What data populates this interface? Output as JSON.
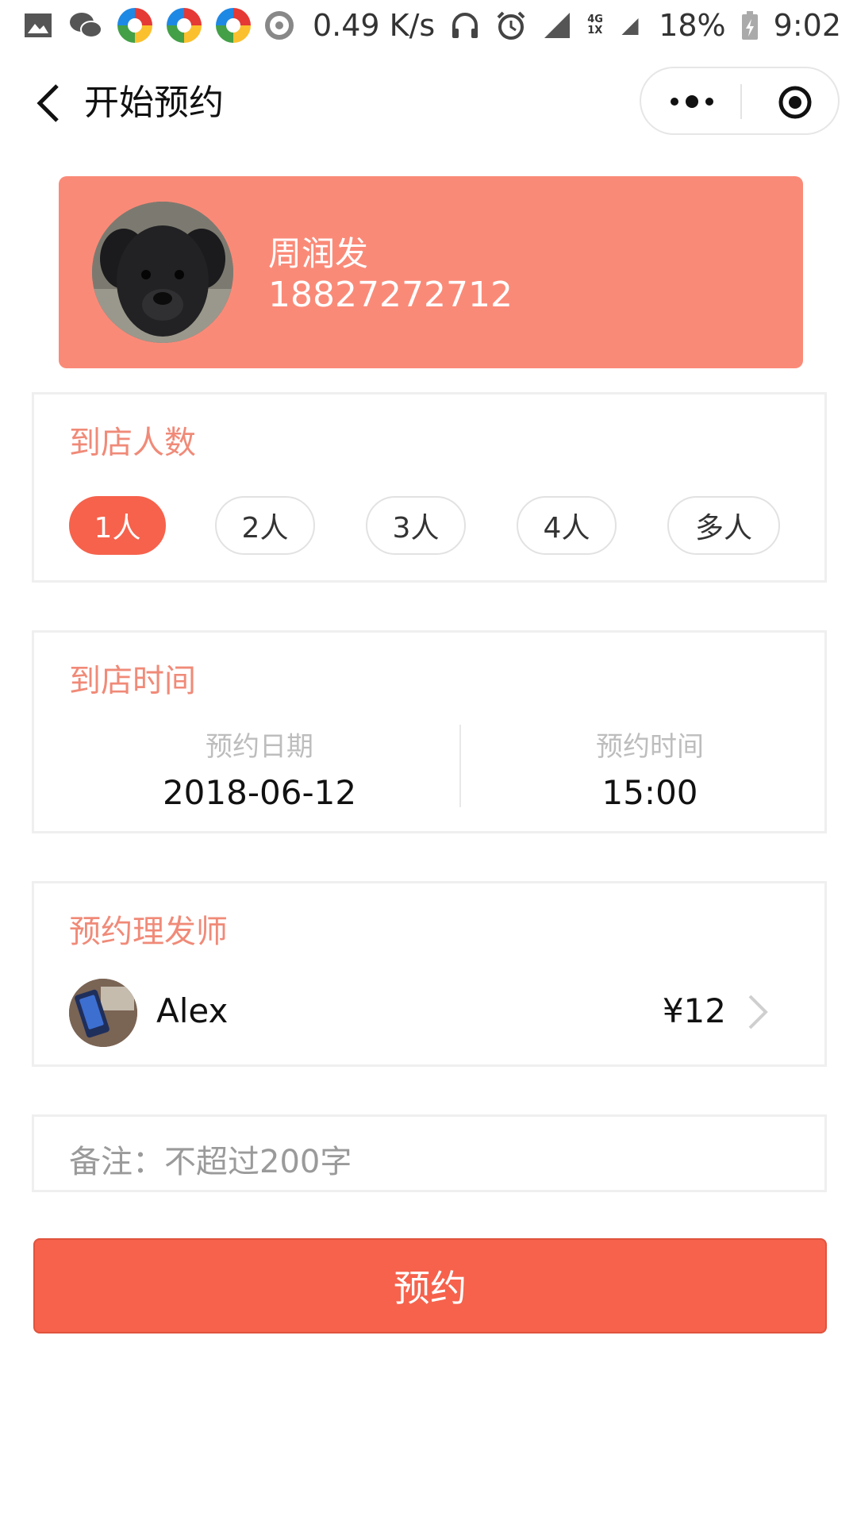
{
  "status_bar": {
    "speed": "0.49 K/s",
    "network": "4G 1X",
    "battery": "18%",
    "time": "9:02"
  },
  "nav": {
    "title": "开始预约"
  },
  "profile": {
    "name": "周润发",
    "phone": "18827272712"
  },
  "people": {
    "title": "到店人数",
    "options": [
      "1人",
      "2人",
      "3人",
      "4人",
      "多人"
    ],
    "selected": "1人"
  },
  "time": {
    "title": "到店时间",
    "date_label": "预约日期",
    "date_value": "2018-06-12",
    "time_label": "预约时间",
    "time_value": "15:00"
  },
  "barber": {
    "title": "预约理发师",
    "name": "Alex",
    "price": "¥12"
  },
  "note": {
    "placeholder": "备注：不超过200字"
  },
  "submit": {
    "label": "预约"
  },
  "colors": {
    "accent": "#f6624c",
    "profile_bg": "#fa8a78",
    "section_title": "#f08a78"
  }
}
